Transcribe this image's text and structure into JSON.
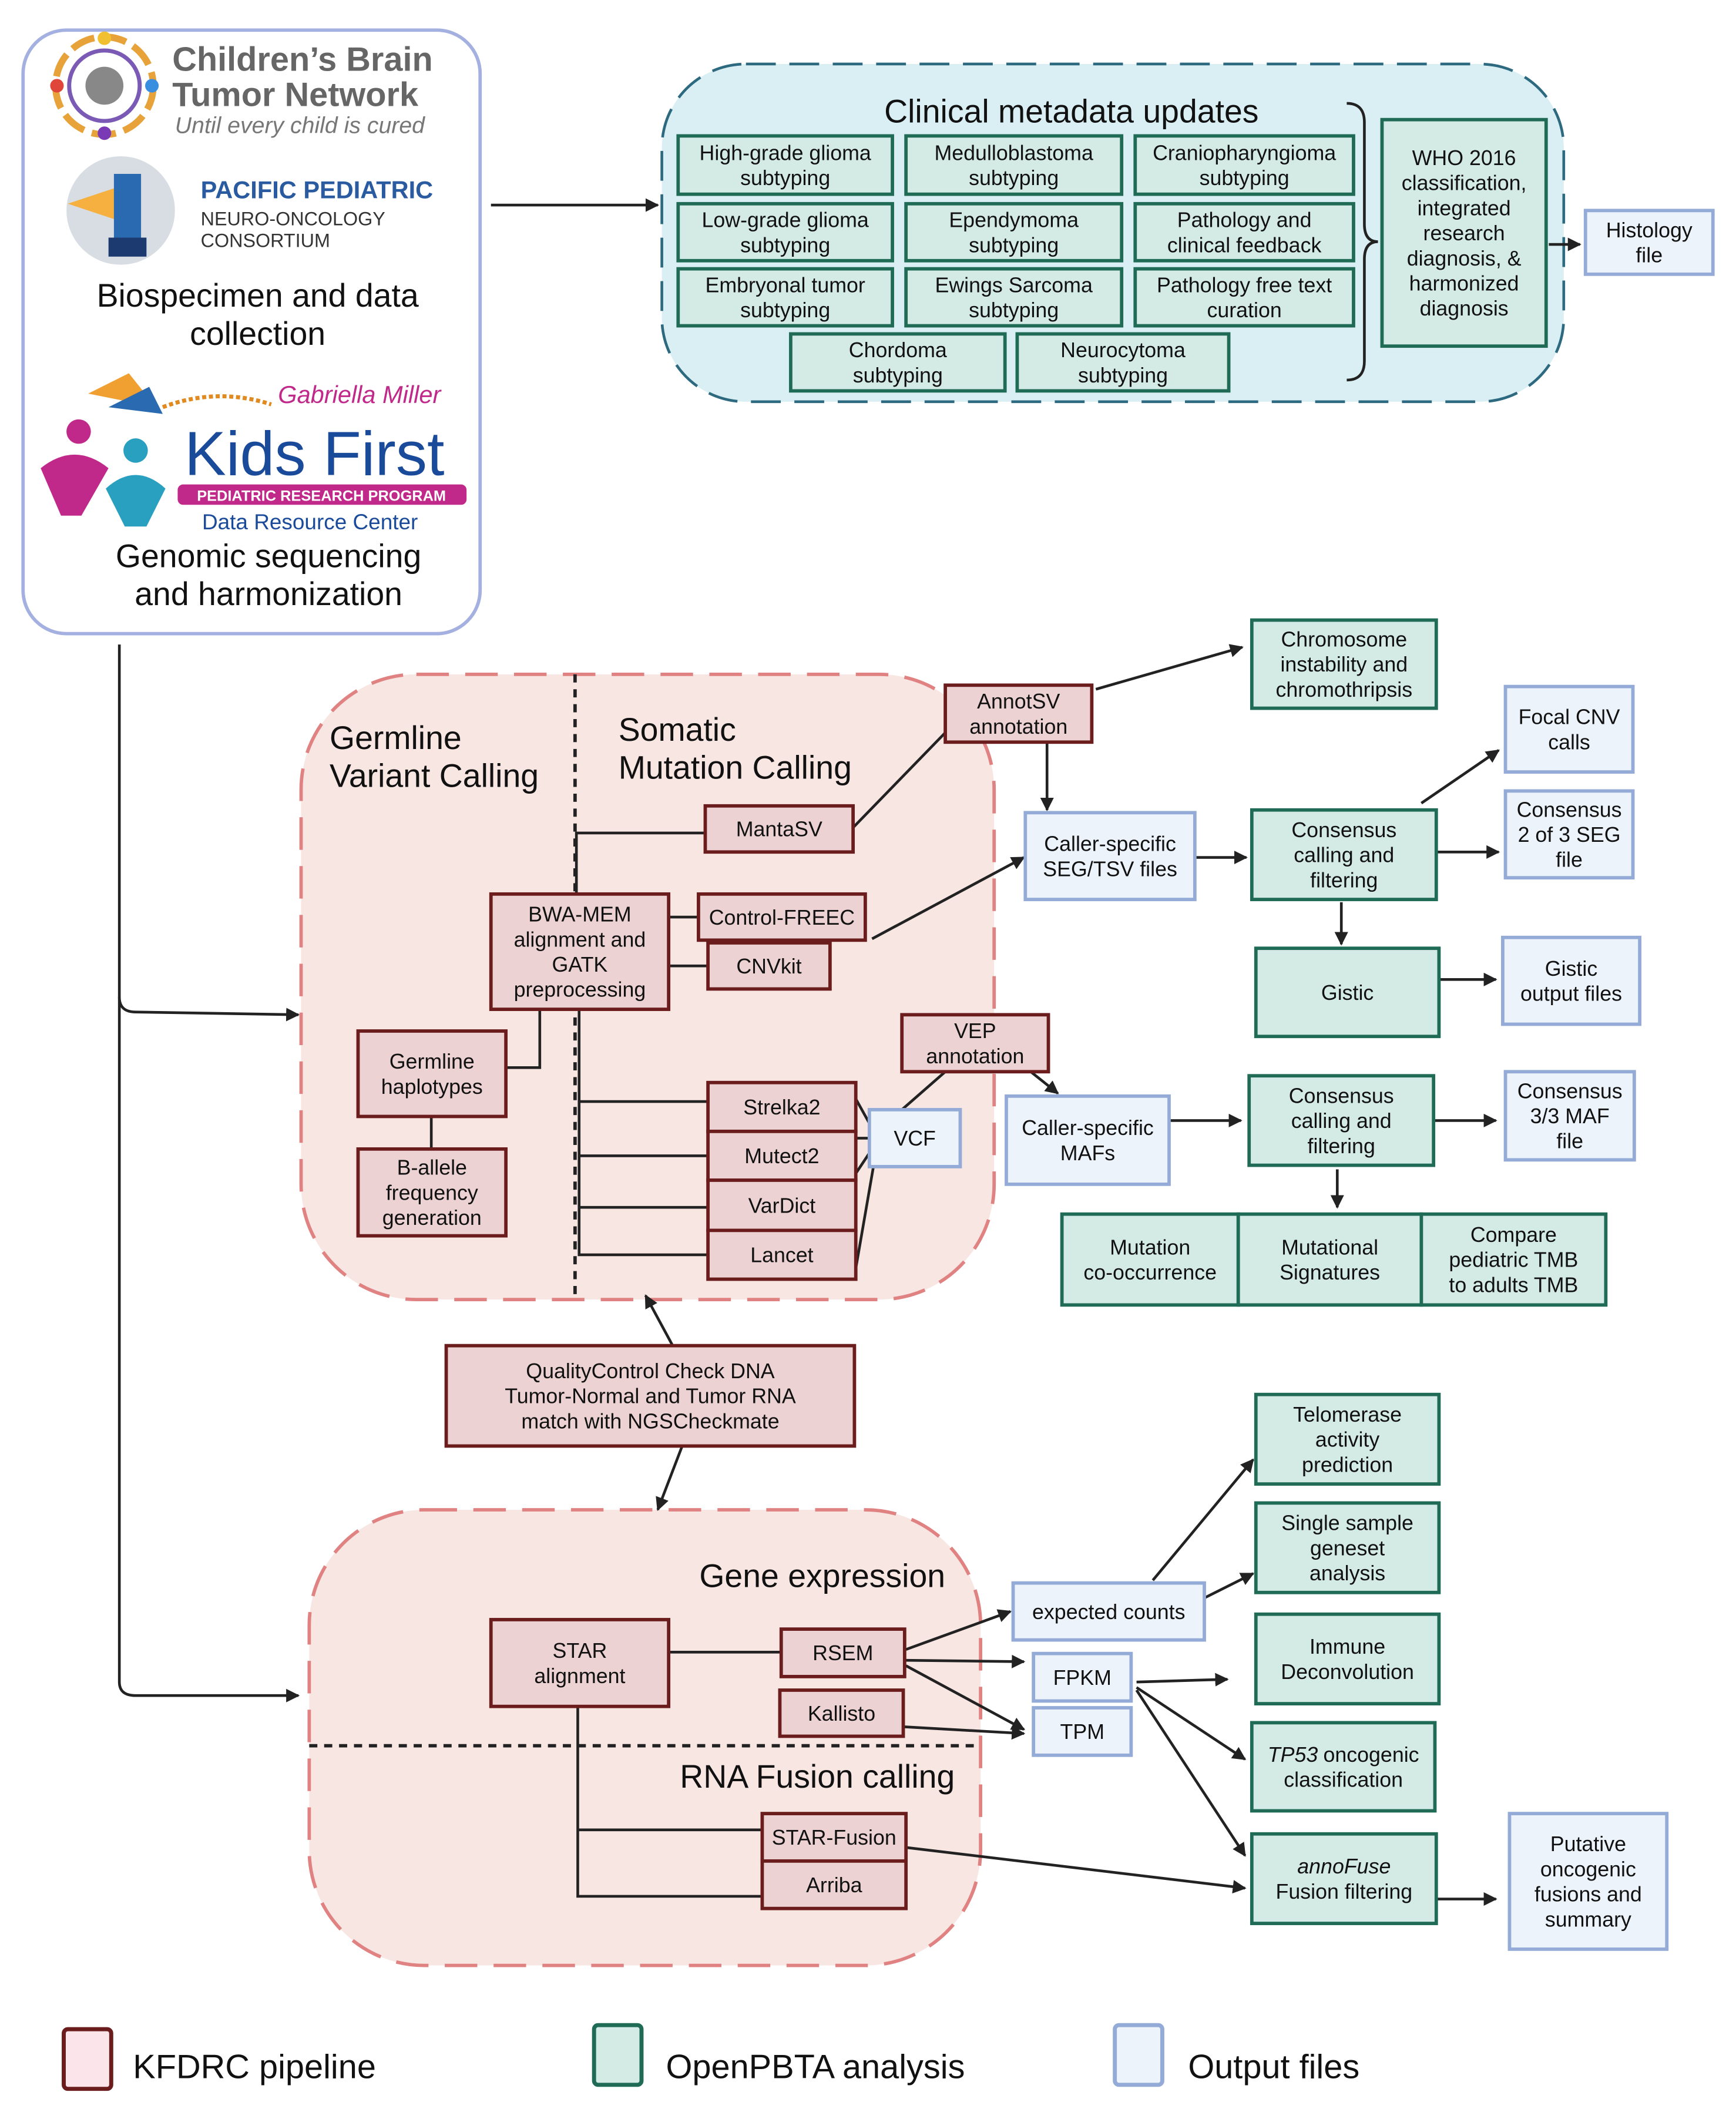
{
  "colors": {
    "kfdrc_fill": "#ecd2d2",
    "kfdrc_stroke": "#6b1c1c",
    "openpbta_fill": "#d4ebe5",
    "openpbta_stroke": "#1f6b55",
    "output_fill": "#edf3fb",
    "output_stroke": "#93abd6",
    "clinical_bg": "#d9eff4",
    "clinical_border": "#2d6a80",
    "pipeline_bg": "#f8e6e3",
    "pipeline_border": "#e08282"
  },
  "left_panel": {
    "cbtn": {
      "line1": "Children’s Brain",
      "line2": "Tumor Network",
      "tagline": "Until every child is cured"
    },
    "pnoc": {
      "line1": "PACIFIC PEDIATRIC",
      "line2": "NEURO-ONCOLOGY",
      "line3": "CONSORTIUM"
    },
    "collection": [
      "Biospecimen and data",
      "collection"
    ],
    "kids_first": {
      "gabriella": "Gabriella Miller",
      "title": "Kids First",
      "banner": "PEDIATRIC RESEARCH PROGRAM",
      "drc": "Data Resource Center"
    },
    "sequencing": [
      "Genomic sequencing",
      "and harmonization"
    ]
  },
  "regions": {
    "clinical_title": "Clinical metadata updates",
    "germline_title": [
      "Germline",
      "Variant Calling"
    ],
    "somatic_title": [
      "Somatic",
      "Mutation Calling"
    ],
    "gene_expression_title": "Gene expression",
    "rna_fusion_title": "RNA Fusion calling"
  },
  "boxes": {
    "hgg": {
      "lines": [
        "High-grade glioma",
        "subtyping"
      ]
    },
    "mb": {
      "lines": [
        "Medulloblastoma",
        "subtyping"
      ]
    },
    "cranio": {
      "lines": [
        "Craniopharyngioma",
        "subtyping"
      ]
    },
    "lgg": {
      "lines": [
        "Low-grade glioma",
        "subtyping"
      ]
    },
    "epn": {
      "lines": [
        "Ependymoma",
        "subtyping"
      ]
    },
    "path_feedback": {
      "lines": [
        "Pathology and",
        "clinical feedback"
      ]
    },
    "emb": {
      "lines": [
        "Embryonal tumor",
        "subtyping"
      ]
    },
    "ewings": {
      "lines": [
        "Ewings Sarcoma",
        "subtyping"
      ]
    },
    "path_free": {
      "lines": [
        "Pathology free text",
        "curation"
      ]
    },
    "chordoma": {
      "lines": [
        "Chordoma",
        "subtyping"
      ]
    },
    "neurocytoma": {
      "lines": [
        "Neurocytoma",
        "subtyping"
      ]
    },
    "who": {
      "lines": [
        "WHO 2016",
        "classification,",
        "integrated",
        "research",
        "diagnosis, &",
        "harmonized",
        "diagnosis"
      ]
    },
    "histology": {
      "lines": [
        "Histology",
        "file"
      ]
    },
    "mantasv": {
      "lines": [
        "MantaSV"
      ]
    },
    "bwa": {
      "lines": [
        "BWA-MEM",
        "alignment and",
        "GATK",
        "preprocessing"
      ]
    },
    "controlfreec": {
      "lines": [
        "Control-FREEC"
      ]
    },
    "cnvkit": {
      "lines": [
        "CNVkit"
      ]
    },
    "haplotypes": {
      "lines": [
        "Germline",
        "haplotypes"
      ]
    },
    "ballele": {
      "lines": [
        "B-allele",
        "frequency",
        "generation"
      ]
    },
    "strelka2": {
      "lines": [
        "Strelka2"
      ]
    },
    "mutect2": {
      "lines": [
        "Mutect2"
      ]
    },
    "vardict": {
      "lines": [
        "VarDict"
      ]
    },
    "lancet": {
      "lines": [
        "Lancet"
      ]
    },
    "vcf": {
      "lines": [
        "VCF"
      ]
    },
    "vep": {
      "lines": [
        "VEP",
        "annotation"
      ]
    },
    "annotsv": {
      "lines": [
        "AnnotSV",
        "annotation"
      ]
    },
    "chromosome": {
      "lines": [
        "Chromosome",
        "instability and",
        "chromothripsis"
      ]
    },
    "seg_files": {
      "lines": [
        "Caller-specific",
        "SEG/TSV  files"
      ]
    },
    "cnv_consensus": {
      "lines": [
        "Consensus",
        "calling and",
        "filtering"
      ]
    },
    "focal_cnv": {
      "lines": [
        "Focal CNV",
        "calls"
      ]
    },
    "consensus_seg": {
      "lines": [
        "Consensus",
        "2 of 3 SEG",
        "file"
      ]
    },
    "gistic": {
      "lines": [
        "Gistic"
      ]
    },
    "gistic_out": {
      "lines": [
        "Gistic",
        "output files"
      ]
    },
    "mafs": {
      "lines": [
        "Caller-specific",
        "MAFs"
      ]
    },
    "snv_consensus": {
      "lines": [
        "Consensus",
        "calling and",
        "filtering"
      ]
    },
    "consensus_maf": {
      "lines": [
        "Consensus",
        "3/3 MAF",
        "file"
      ]
    },
    "cooccurrence": {
      "lines": [
        "Mutation",
        "co-occurrence"
      ]
    },
    "signatures": {
      "lines": [
        "Mutational",
        "Signatures"
      ]
    },
    "tmb": {
      "lines": [
        "Compare",
        "pediatric TMB",
        "to adults TMB"
      ]
    },
    "qc": {
      "lines": [
        "QualityControl Check DNA",
        "Tumor-Normal and Tumor RNA",
        "match with NGSCheckmate"
      ]
    },
    "star": {
      "lines": [
        "STAR",
        "alignment"
      ]
    },
    "rsem": {
      "lines": [
        "RSEM"
      ]
    },
    "kallisto": {
      "lines": [
        "Kallisto"
      ]
    },
    "starfusion": {
      "lines": [
        "STAR-Fusion"
      ]
    },
    "arriba": {
      "lines": [
        "Arriba"
      ]
    },
    "expected_counts": {
      "lines": [
        "expected counts"
      ]
    },
    "fpkm": {
      "lines": [
        "FPKM"
      ]
    },
    "tpm": {
      "lines": [
        "TPM"
      ]
    },
    "telomerase": {
      "lines": [
        "Telomerase",
        "activity",
        "prediction"
      ]
    },
    "ssgsea": {
      "lines": [
        "Single sample",
        "geneset",
        "analysis"
      ]
    },
    "immune": {
      "lines": [
        "Immune",
        "Deconvolution"
      ]
    },
    "tp53": {
      "italic_prefix": "TP53",
      "lines": [
        "oncogenic",
        "classification"
      ]
    },
    "annofuse": {
      "italic_prefix": "annoFuse",
      "lines": [
        "",
        "Fusion filtering"
      ]
    },
    "putative": {
      "lines": [
        "Putative",
        "oncogenic",
        "fusions and",
        "summary"
      ]
    }
  },
  "legend": [
    {
      "label": "KFDRC pipeline",
      "kind": "kfdrc"
    },
    {
      "label": "OpenPBTA analysis",
      "kind": "openpbta"
    },
    {
      "label": "Output files",
      "kind": "output"
    }
  ]
}
